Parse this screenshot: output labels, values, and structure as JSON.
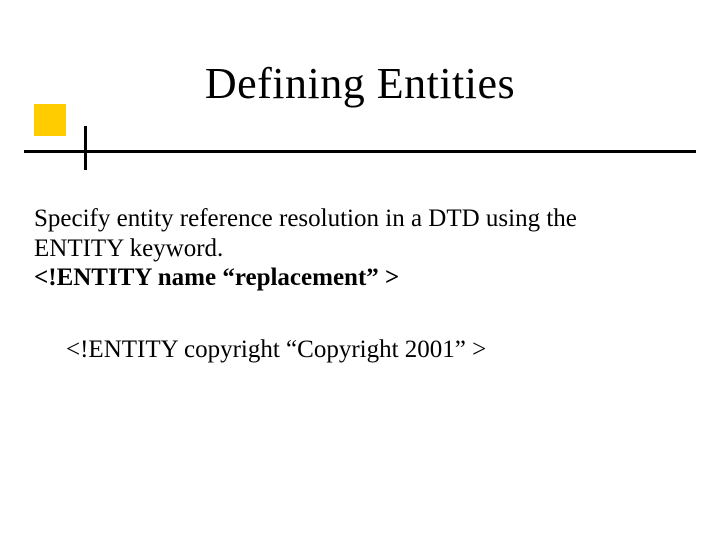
{
  "title": "Defining Entities",
  "body": {
    "line1": "Specify entity reference resolution in a DTD using the",
    "line2": "ENTITY keyword.",
    "line3": "<!ENTITY name “replacement” >"
  },
  "example": "<!ENTITY copyright  “Copyright 2001” >"
}
